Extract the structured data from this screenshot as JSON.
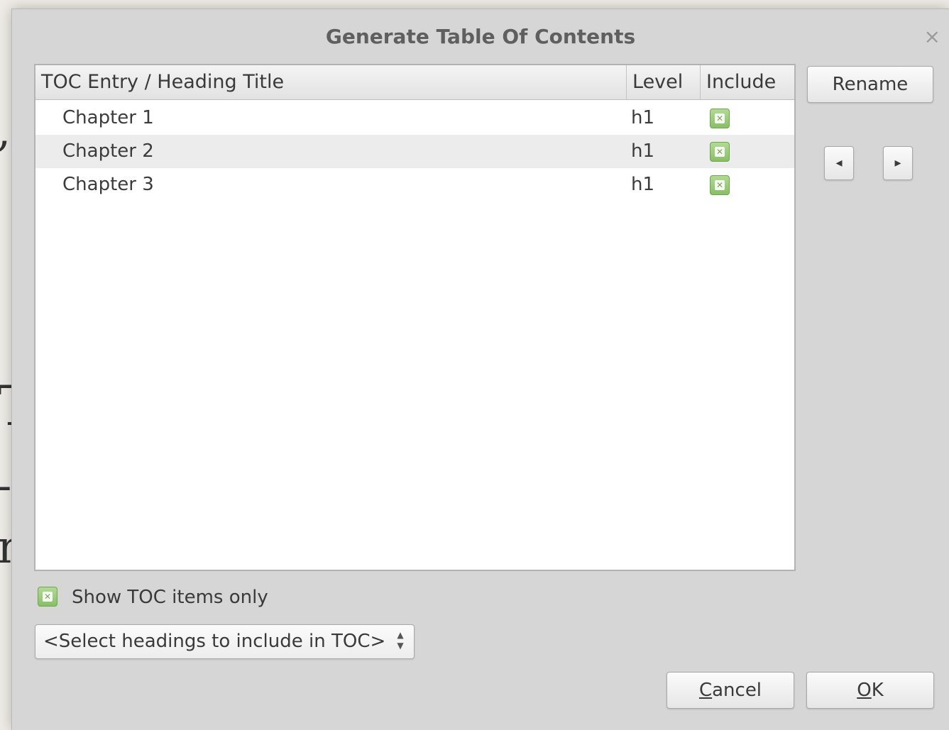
{
  "background": {
    "glyph1": ",",
    "glyph2": "T",
    "glyph3": "-",
    "glyph4": "n"
  },
  "dialog": {
    "title": "Generate Table Of Contents",
    "close_label": "×"
  },
  "table": {
    "columns": [
      "TOC Entry / Heading Title",
      "Level",
      "Include"
    ],
    "rows": [
      {
        "title": "Chapter 1",
        "level": "h1",
        "include": true
      },
      {
        "title": "Chapter 2",
        "level": "h1",
        "include": true
      },
      {
        "title": "Chapter 3",
        "level": "h1",
        "include": true
      }
    ]
  },
  "side_buttons": {
    "rename": "Rename",
    "left_arrow": "◂",
    "right_arrow": "▸"
  },
  "options": {
    "show_toc_only_label": "Show TOC items only",
    "show_toc_only_checked": true,
    "select_headings_value": "<Select headings to include in TOC>",
    "spin_up": "▲",
    "spin_down": "▼"
  },
  "footer": {
    "cancel_mnemonic": "C",
    "cancel_rest": "ancel",
    "ok_mnemonic": "O",
    "ok_rest": "K"
  },
  "colors": {
    "dialog_bg": "#d6d6d6",
    "checkbox_green": "#88bf67"
  }
}
